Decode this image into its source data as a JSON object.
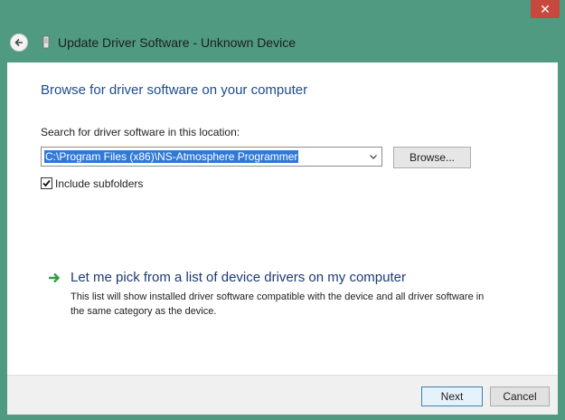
{
  "window": {
    "close_glyph": "✕",
    "title": "Update Driver Software - Unknown Device"
  },
  "content": {
    "heading": "Browse for driver software on your computer",
    "search_label": "Search for driver software in this location:",
    "path_value": "C:\\Program Files (x86)\\NS-Atmosphere Programmer",
    "browse_label": "Browse...",
    "include_subfolders_label": "Include subfolders",
    "include_subfolders_checked": true,
    "pick_link": "Let me pick from a list of device drivers on my computer",
    "pick_description": "This list will show installed driver software compatible with the device and all driver software in the same category as the device."
  },
  "footer": {
    "next_label": "Next",
    "cancel_label": "Cancel"
  },
  "colors": {
    "background": "#4f9a80",
    "close_button": "#c7493e",
    "heading": "#1c4a8f",
    "selection": "#3079d7",
    "link_arrow": "#2ea043"
  },
  "icons": [
    "back-arrow-icon",
    "device-icon",
    "chevron-down-icon",
    "checkmark-icon",
    "green-arrow-icon"
  ]
}
